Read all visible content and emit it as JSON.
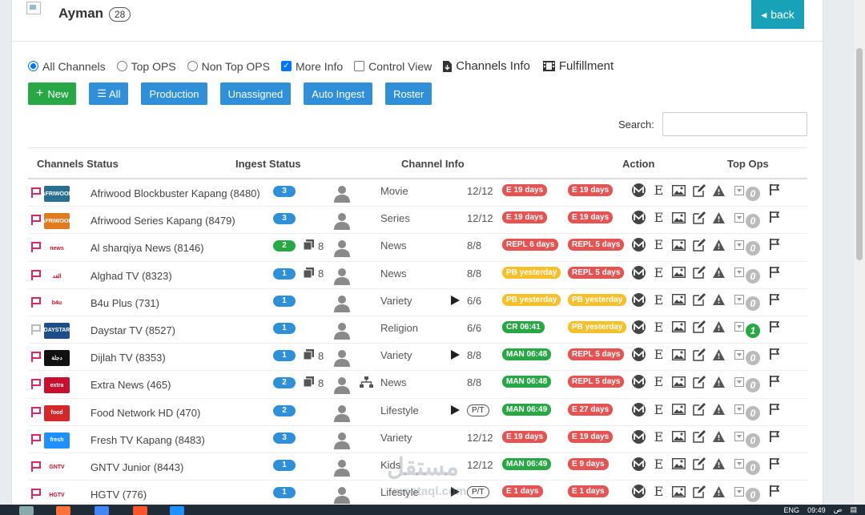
{
  "header": {
    "title": "Ayman",
    "count": "28",
    "back_label": "back"
  },
  "filters": [
    {
      "type": "radio",
      "label": "All Channels",
      "checked": true
    },
    {
      "type": "radio",
      "label": "Top OPS",
      "checked": false
    },
    {
      "type": "radio",
      "label": "Non Top OPS",
      "checked": false
    },
    {
      "type": "checkbox",
      "label": "More Info",
      "checked": true
    },
    {
      "type": "checkbox",
      "label": "Control View",
      "checked": false
    }
  ],
  "links": {
    "channels_info": "Channels Info",
    "fulfillment": "Fulfillment"
  },
  "toolbar": {
    "new": "New",
    "all": "All",
    "production": "Production",
    "unassigned": "Unassigned",
    "auto_ingest": "Auto Ingest",
    "roster": "Roster"
  },
  "search": {
    "label": "Search:",
    "value": ""
  },
  "columns": {
    "channels_status": "Channels Status",
    "ingest_status": "Ingest Status",
    "channel_info": "Channel Info",
    "action": "Action",
    "top_ops": "Top Ops"
  },
  "rows": [
    {
      "name": "Afriwood Blockbuster Kapang (8480)",
      "ingest": "3",
      "ingest_color": "blue",
      "copies": "",
      "genre": "Movie",
      "play": false,
      "pt": false,
      "ratio": "12/12",
      "tag1": "E 19 days",
      "tag1c": "red",
      "tag2": "E 19 days",
      "tag2c": "red",
      "top_ops": "0",
      "top_green": false,
      "flag": "#e0245e",
      "logo_bg": "#2a6f8f",
      "logo_text": "AFRIWOOD",
      "net": false
    },
    {
      "name": "Afriwood Series Kapang (8479)",
      "ingest": "3",
      "ingest_color": "blue",
      "copies": "",
      "genre": "Series",
      "play": false,
      "pt": false,
      "ratio": "12/12",
      "tag1": "E 19 days",
      "tag1c": "red",
      "tag2": "E 19 days",
      "tag2c": "red",
      "top_ops": "0",
      "top_green": false,
      "flag": "#e0245e",
      "logo_bg": "#e07b1f",
      "logo_text": "AFRIWOOD",
      "net": false
    },
    {
      "name": "Al sharqiya News (8146)",
      "ingest": "2",
      "ingest_color": "green",
      "copies": "8",
      "genre": "News",
      "play": false,
      "pt": false,
      "ratio": "8/8",
      "tag1": "REPL 6 days",
      "tag1c": "red",
      "tag2": "REPL 5 days",
      "tag2c": "red",
      "top_ops": "0",
      "top_green": false,
      "flag": "#e0245e",
      "logo_bg": "#ffffff",
      "logo_text": "news",
      "net": false
    },
    {
      "name": "Alghad TV (8323)",
      "ingest": "1",
      "ingest_color": "blue",
      "copies": "8",
      "genre": "News",
      "play": false,
      "pt": false,
      "ratio": "8/8",
      "tag1": "PB yesterday",
      "tag1c": "yellow",
      "tag2": "REPL 5 days",
      "tag2c": "red",
      "top_ops": "0",
      "top_green": false,
      "flag": "#e0245e",
      "logo_bg": "#ffffff",
      "logo_text": "الغد",
      "net": false
    },
    {
      "name": "B4u Plus (731)",
      "ingest": "1",
      "ingest_color": "blue",
      "copies": "",
      "genre": "Variety",
      "play": true,
      "pt": false,
      "ratio": "6/6",
      "tag1": "PB yesterday",
      "tag1c": "yellow",
      "tag2": "PB yesterday",
      "tag2c": "yellow",
      "top_ops": "0",
      "top_green": false,
      "flag": "#e0245e",
      "logo_bg": "#ffffff",
      "logo_text": "b4u",
      "net": false
    },
    {
      "name": "Daystar TV (8527)",
      "ingest": "1",
      "ingest_color": "blue",
      "copies": "",
      "genre": "Religion",
      "play": false,
      "pt": false,
      "ratio": "6/6",
      "tag1": "CR 06:41",
      "tag1c": "green",
      "tag2": "PB yesterday",
      "tag2c": "yellow",
      "top_ops": "1",
      "top_green": true,
      "flag": "#bbbbbb",
      "logo_bg": "#1d4e89",
      "logo_text": "DAYSTAR",
      "net": false
    },
    {
      "name": "Dijlah TV (8353)",
      "ingest": "1",
      "ingest_color": "blue",
      "copies": "8",
      "genre": "Variety",
      "play": true,
      "pt": false,
      "ratio": "8/8",
      "tag1": "MAN 06:48",
      "tag1c": "green",
      "tag2": "REPL 5 days",
      "tag2c": "red",
      "top_ops": "0",
      "top_green": false,
      "flag": "#e0245e",
      "logo_bg": "#111111",
      "logo_text": "دجلة",
      "net": false
    },
    {
      "name": "Extra News (465)",
      "ingest": "2",
      "ingest_color": "blue",
      "copies": "8",
      "genre": "News",
      "play": false,
      "pt": false,
      "ratio": "8/8",
      "tag1": "MAN 06:48",
      "tag1c": "green",
      "tag2": "REPL 5 days",
      "tag2c": "red",
      "top_ops": "0",
      "top_green": false,
      "flag": "#e0245e",
      "logo_bg": "#c8102e",
      "logo_text": "extra",
      "net": true
    },
    {
      "name": "Food Network HD (470)",
      "ingest": "2",
      "ingest_color": "blue",
      "copies": "",
      "genre": "Lifestyle",
      "play": true,
      "pt": true,
      "ratio": "",
      "tag1": "MAN 06:49",
      "tag1c": "green",
      "tag2": "E 27 days",
      "tag2c": "red",
      "top_ops": "0",
      "top_green": false,
      "flag": "#e0245e",
      "logo_bg": "#d62828",
      "logo_text": "food",
      "net": false
    },
    {
      "name": "Fresh TV Kapang (8483)",
      "ingest": "3",
      "ingest_color": "blue",
      "copies": "",
      "genre": "Variety",
      "play": false,
      "pt": false,
      "ratio": "12/12",
      "tag1": "E 19 days",
      "tag1c": "red",
      "tag2": "E 19 days",
      "tag2c": "red",
      "top_ops": "0",
      "top_green": false,
      "flag": "#e0245e",
      "logo_bg": "#1e90ff",
      "logo_text": "fresh",
      "net": false
    },
    {
      "name": "GNTV Junior (8443)",
      "ingest": "1",
      "ingest_color": "blue",
      "copies": "",
      "genre": "Kids",
      "play": false,
      "pt": false,
      "ratio": "12/12",
      "tag1": "MAN 06:49",
      "tag1c": "green",
      "tag2": "E 9 days",
      "tag2c": "red",
      "top_ops": "0",
      "top_green": false,
      "flag": "#e0245e",
      "logo_bg": "#ffffff",
      "logo_text": "GNTV",
      "net": false
    },
    {
      "name": "HGTV (776)",
      "ingest": "1",
      "ingest_color": "blue",
      "copies": "",
      "genre": "Lifestyle",
      "play": true,
      "pt": true,
      "ratio": "",
      "tag1": "E 1 days",
      "tag1c": "red",
      "tag2": "E 1 days",
      "tag2c": "red",
      "top_ops": "0",
      "top_green": false,
      "flag": "#e0245e",
      "logo_bg": "#ffffff",
      "logo_text": "HGTV",
      "net": false
    }
  ],
  "pt_label": "P/T",
  "watermark": {
    "arabic": "مستقل",
    "latin": "mostaql.com"
  },
  "taskbar": {
    "time": "09:49",
    "ampm": "ص",
    "lang": "ENG"
  }
}
